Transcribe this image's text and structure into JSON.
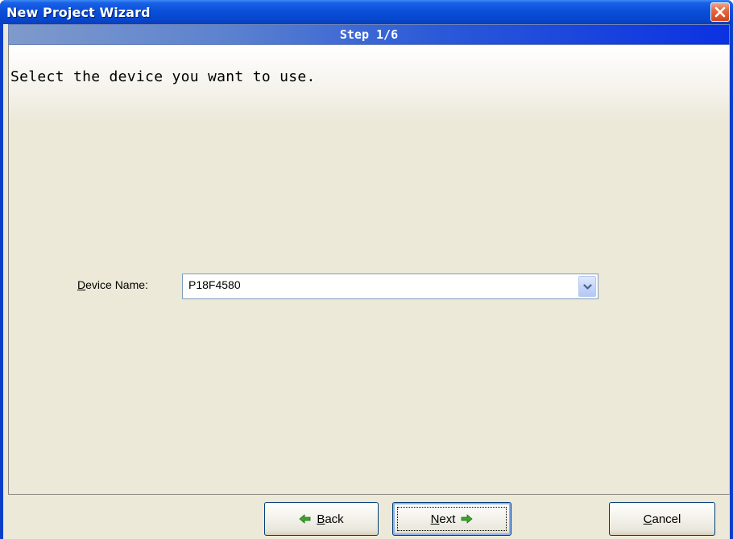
{
  "window": {
    "title": "New Project Wizard",
    "close_icon": "close-icon"
  },
  "stepbar": {
    "text": "Step 1/6"
  },
  "instruction": "Select the device you want to use.",
  "device": {
    "label_mnemonic": "D",
    "label_rest": "evice Name:",
    "value": "P18F4580",
    "dropdown_icon": "chevron-down-icon"
  },
  "buttons": {
    "back": {
      "mnemonic": "B",
      "rest": "ack",
      "icon": "arrow-left-icon"
    },
    "next": {
      "mnemonic": "N",
      "rest": "ext",
      "icon": "arrow-right-icon"
    },
    "cancel": {
      "mnemonic": "C",
      "rest": "ancel"
    }
  },
  "colors": {
    "titlebar": "#0a4fd9",
    "stepbar_end": "#0a32e2",
    "client_bg": "#ece9d8",
    "close_button": "#e5683f",
    "arrow_green": "#3aa52b"
  }
}
